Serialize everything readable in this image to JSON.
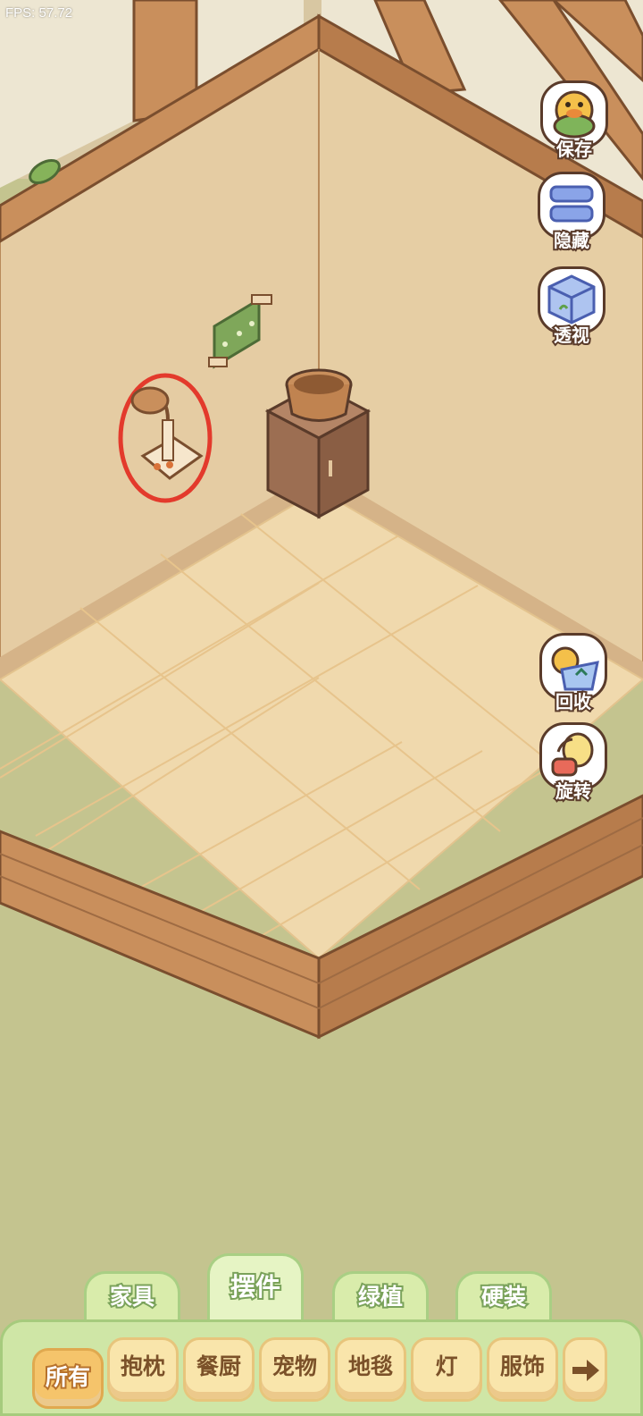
{
  "hud": {
    "fps": "FPS: 57.72"
  },
  "side_tools": {
    "save": "保存",
    "hide": "隐藏",
    "perspective": "透视",
    "recycle": "回收",
    "rotate": "旋转"
  },
  "category_tabs": [
    "家具",
    "摆件",
    "绿植",
    "硬装"
  ],
  "active_tab": "摆件",
  "subcategories": [
    "所有",
    "抱枕",
    "餐厨",
    "宠物",
    "地毯",
    "灯",
    "服饰"
  ],
  "active_subcategory": "所有",
  "colors": {
    "wall": "#e5cca3",
    "floor": "#f0d9ad",
    "wood": "#c98f5c",
    "grass": "#c4c48f",
    "tab_green": "#d9ecab",
    "chip_yellow": "#f9e5ab",
    "chip_active": "#f5c46b"
  }
}
